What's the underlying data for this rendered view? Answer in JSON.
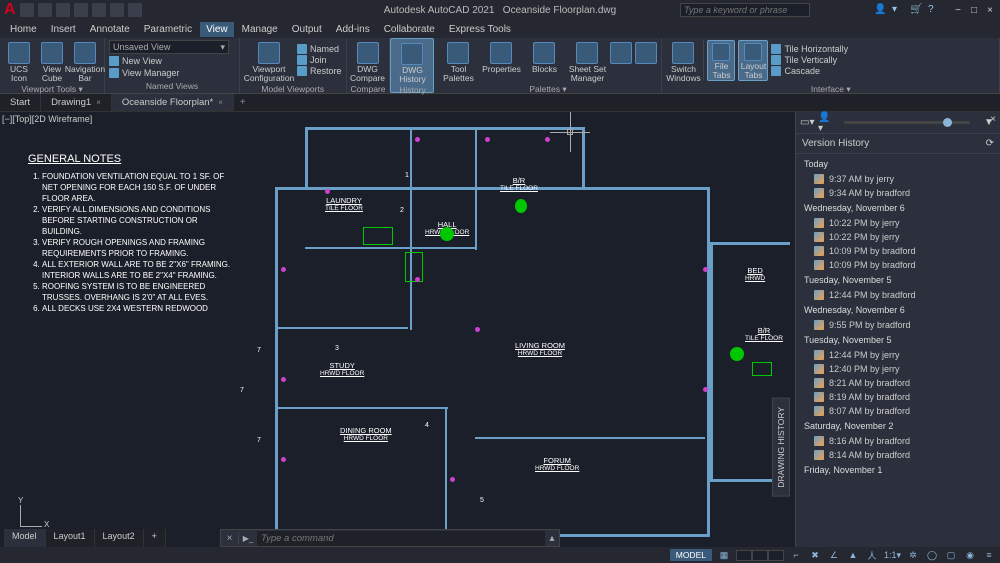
{
  "app": {
    "title": "Autodesk AutoCAD 2021",
    "document": "Oceanside Floorplan.dwg",
    "search_placeholder": "Type a keyword or phrase"
  },
  "menu": [
    "Home",
    "Insert",
    "Annotate",
    "Parametric",
    "View",
    "Manage",
    "Output",
    "Add-ins",
    "Collaborate",
    "Express Tools"
  ],
  "menu_active": "View",
  "ribbon": {
    "viewport_tools": {
      "label": "Viewport Tools ▾",
      "buttons": [
        {
          "label": "UCS\nIcon"
        },
        {
          "label": "View\nCube"
        },
        {
          "label": "Navigation\nBar"
        }
      ]
    },
    "named_views": {
      "label": "Named Views",
      "combo": "Unsaved View",
      "items": [
        "New View",
        "View Manager"
      ]
    },
    "model_viewports": {
      "label": "Model Viewports",
      "button": "Viewport\nConfiguration",
      "items": [
        "Named",
        "Join",
        "Restore"
      ]
    },
    "compare": {
      "label": "Compare",
      "button": "DWG\nCompare"
    },
    "history": {
      "label": "History",
      "button": "DWG\nHistory"
    },
    "palettes": {
      "label": "Palettes ▾",
      "buttons": [
        "Tool\nPalettes",
        "Properties",
        "Blocks",
        "Sheet Set\nManager",
        "",
        ""
      ]
    },
    "interface": {
      "label": "Interface ▾",
      "switch": "Switch\nWindows",
      "file_tabs": "File\nTabs",
      "layout_tabs": "Layout\nTabs",
      "items": [
        "Tile Horizontally",
        "Tile Vertically",
        "Cascade"
      ]
    }
  },
  "doc_tabs": [
    {
      "label": "Start",
      "active": false,
      "closable": false
    },
    {
      "label": "Drawing1",
      "active": false,
      "closable": true
    },
    {
      "label": "Oceanside Floorplan*",
      "active": true,
      "closable": true
    }
  ],
  "viewport": {
    "label_parts": [
      "[−]",
      "[Top]",
      "[2D Wireframe]"
    ],
    "notes_title": "GENERAL NOTES",
    "notes": [
      "FOUNDATION VENTILATION EQUAL TO 1 SF. OF NET OPENING FOR EACH 150 S.F. OF UNDER FLOOR AREA.",
      "VERIFY ALL DIMENSIONS AND CONDITIONS BEFORE STARTING CONSTRUCTION OR BUILDING.",
      "VERIFY ROUGH OPENINGS AND FRAMING REQUIREMENTS PRIOR TO FRAMING.",
      "ALL EXTERIOR WALL ARE TO BE 2\"X6\" FRAMING. INTERIOR WALLS ARE TO BE 2\"X4\" FRAMING.",
      "ROOFING SYSTEM IS TO BE ENGINEERED TRUSSES. OVERHANG IS 2'0\" AT ALL EVES.",
      "ALL DECKS USE 2X4 WESTERN REDWOOD"
    ],
    "rooms": [
      {
        "name": "LAUNDRY",
        "sub": "TILE FLOOR"
      },
      {
        "name": "B/R",
        "sub": "TILE\nFLOOR"
      },
      {
        "name": "HALL",
        "sub": "HRWD\nFLOOR"
      },
      {
        "name": "STUDY",
        "sub": "HRWD FLOOR"
      },
      {
        "name": "LIVING ROOM",
        "sub": "HRWD FLOOR"
      },
      {
        "name": "DINING ROOM",
        "sub": "HRWD FLOOR"
      },
      {
        "name": "FORUM",
        "sub": "HRWD FLOOR"
      },
      {
        "name": "BED",
        "sub": "HRWD"
      },
      {
        "name": "B/R",
        "sub": "TILE\nFLOOR"
      }
    ],
    "ucs": {
      "x": "X",
      "y": "Y"
    }
  },
  "version_history": {
    "title": "Version History",
    "groups": [
      {
        "day": "Today",
        "entries": [
          {
            "t": "9:37 AM by jerry"
          },
          {
            "t": "9:34 AM by bradford"
          }
        ]
      },
      {
        "day": "Wednesday, November 6",
        "entries": [
          {
            "t": "10:22 PM by jerry"
          },
          {
            "t": "10:22 PM by jerry"
          },
          {
            "t": "10:09 PM by bradford"
          },
          {
            "t": "10:09 PM by bradford"
          }
        ]
      },
      {
        "day": "Tuesday, November 5",
        "entries": [
          {
            "t": "12:44 PM by bradford"
          }
        ]
      },
      {
        "day": "Wednesday, November 6",
        "entries": [
          {
            "t": "9:55 PM by bradford"
          }
        ]
      },
      {
        "day": "Tuesday, November 5",
        "entries": [
          {
            "t": "12:44 PM by jerry"
          },
          {
            "t": "12:40 PM by jerry"
          },
          {
            "t": "8:21 AM by bradford"
          },
          {
            "t": "8:19 AM by bradford"
          },
          {
            "t": "8:07 AM by bradford"
          }
        ]
      },
      {
        "day": "Saturday, November 2",
        "entries": [
          {
            "t": "8:16 AM by bradford"
          },
          {
            "t": "8:14 AM by bradford"
          }
        ]
      },
      {
        "day": "Friday, November 1",
        "entries": []
      }
    ],
    "side_tab": "DRAWING HISTORY"
  },
  "cmdline": {
    "placeholder": "Type a command"
  },
  "layout_tabs": [
    "Model",
    "Layout1",
    "Layout2"
  ],
  "statusbar": {
    "model": "MODEL"
  }
}
